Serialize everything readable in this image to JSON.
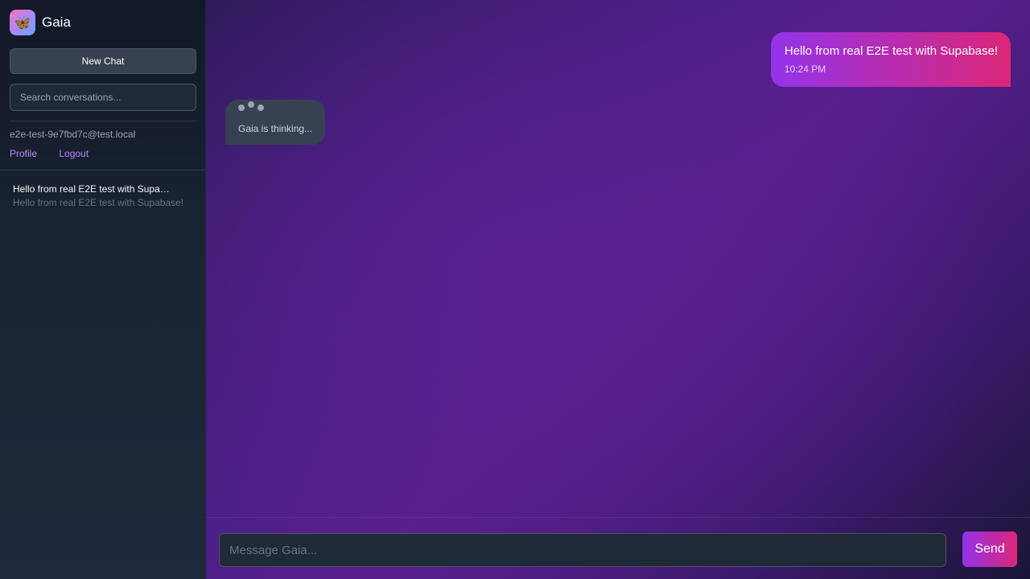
{
  "sidebar": {
    "brand": {
      "logo_icon": "butterfly-icon",
      "logo_glyph": "🦋",
      "title": "Gaia"
    },
    "new_chat_label": "New Chat",
    "search_placeholder": "Search conversations...",
    "user_email": "e2e-test-9e7fbd7c@test.local",
    "profile_label": "Profile",
    "logout_label": "Logout",
    "conversations": [
      {
        "title": "Hello from real E2E test with Supabase!",
        "preview": "Hello from real E2E test with Supabase!"
      }
    ]
  },
  "chat": {
    "messages": [
      {
        "role": "user",
        "text": "Hello from real E2E test with Supabase!",
        "time": "10:24 PM"
      }
    ],
    "thinking_text": "Gaia is thinking..."
  },
  "composer": {
    "placeholder": "Message Gaia...",
    "send_label": "Send"
  },
  "colors": {
    "accent_start": "#9333ea",
    "accent_end": "#db2777",
    "link": "#c084fc",
    "sidebar_bg": "#111827"
  }
}
